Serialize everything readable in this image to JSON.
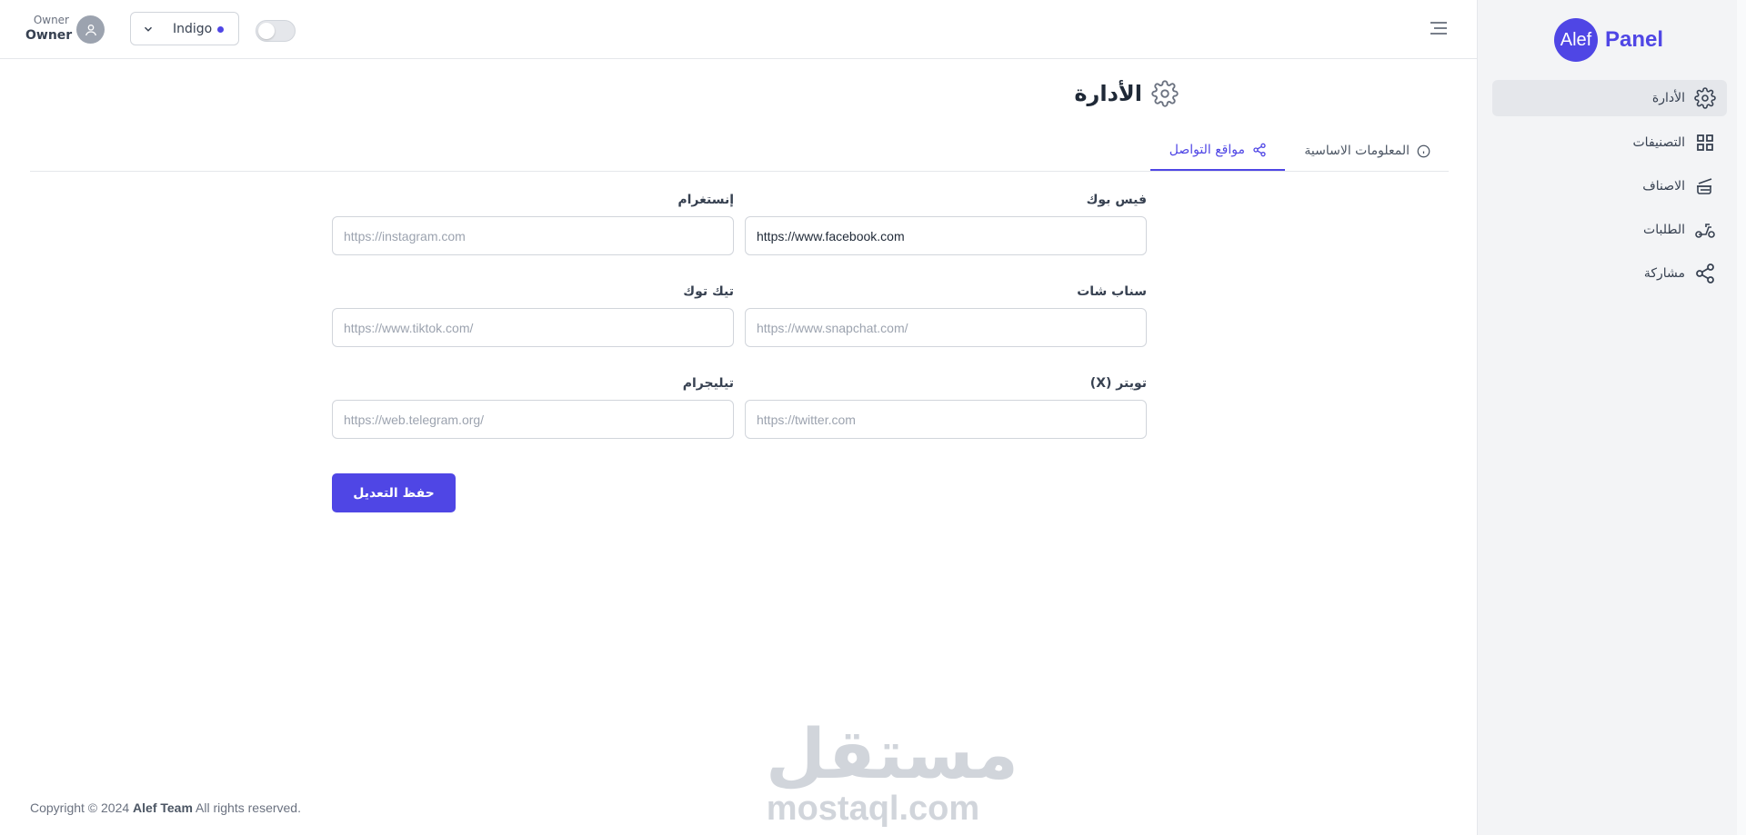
{
  "header": {
    "user_role": "Owner",
    "user_name": "Owner",
    "theme_label": "Indigo",
    "accent_color": "#4f46e5"
  },
  "page": {
    "title": "الأدارة",
    "tabs": [
      {
        "label": "المعلومات الاساسية",
        "active": false,
        "icon": "info-icon"
      },
      {
        "label": "مواقع التواصل",
        "active": true,
        "icon": "share-icon"
      }
    ]
  },
  "form": {
    "facebook": {
      "label": "فيس بوك",
      "value": "https://www.facebook.com",
      "placeholder": "https://www.facebook.com"
    },
    "instagram": {
      "label": "إنستغرام",
      "value": "",
      "placeholder": "https://instagram.com"
    },
    "snapchat": {
      "label": "سناب شات",
      "value": "",
      "placeholder": "https://www.snapchat.com/"
    },
    "tiktok": {
      "label": "تيك توك",
      "value": "",
      "placeholder": "https://www.tiktok.com/"
    },
    "twitter": {
      "label": "تويتر (X)",
      "value": "",
      "placeholder": "https://twitter.com"
    },
    "telegram": {
      "label": "تيليجرام",
      "value": "",
      "placeholder": "https://web.telegram.org/"
    },
    "save_label": "حفظ التعديل"
  },
  "footer": {
    "prefix": "Copyright © 2024",
    "team": "Alef Team",
    "suffix": "All rights reserved."
  },
  "watermark": {
    "arabic": "مستقل",
    "latin": "mostaql.com"
  },
  "sidebar": {
    "logo_circle": "Alef",
    "logo_word": "Panel",
    "items": [
      {
        "label": "الأدارة",
        "icon": "gear-icon",
        "active": true
      },
      {
        "label": "التصنيفات",
        "icon": "grid-icon",
        "active": false
      },
      {
        "label": "الاصناف",
        "icon": "burger-icon",
        "active": false
      },
      {
        "label": "الطلبات",
        "icon": "scooter-icon",
        "active": false
      },
      {
        "label": "مشاركة",
        "icon": "share-icon",
        "active": false
      }
    ]
  }
}
